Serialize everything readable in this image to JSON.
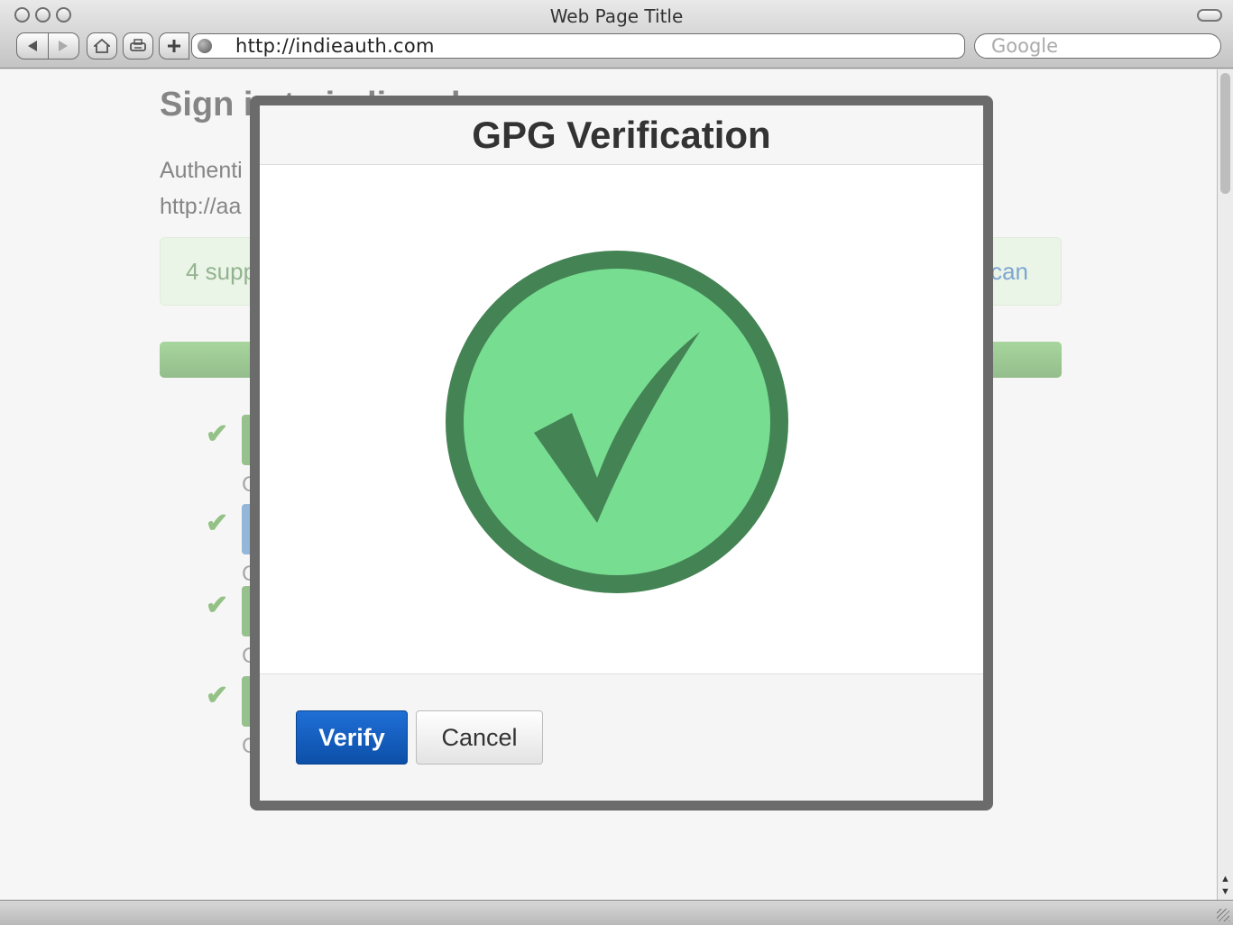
{
  "window": {
    "title": "Web Page Title"
  },
  "toolbar": {
    "url": "http://indieauth.com",
    "search_placeholder": "Google",
    "icons": [
      "back-icon",
      "forward-icon",
      "home-icon",
      "print-icon",
      "add-bookmark-icon",
      "globe-icon"
    ]
  },
  "page": {
    "heading": "Sign in to indiewebcamp.com",
    "auth_line1": "Authenti",
    "auth_line2": "http://aa",
    "alert_text": "4 supp",
    "alert_link": "can",
    "provider_rows": [
      {
        "letter": "C",
        "color": "#5f9e4f"
      },
      {
        "letter": "C",
        "color": "#5b8fc4"
      },
      {
        "letter": "C",
        "color": "#5f9e4f"
      },
      {
        "letter": "C",
        "color": "#5f9e4f"
      }
    ]
  },
  "modal": {
    "title": "GPG Verification",
    "status_icon": "checkmark-circle-icon",
    "colors": {
      "circle_fill": "#77dd91",
      "circle_border": "#448354",
      "check": "#448354"
    },
    "verify_label": "Verify",
    "cancel_label": "Cancel"
  }
}
